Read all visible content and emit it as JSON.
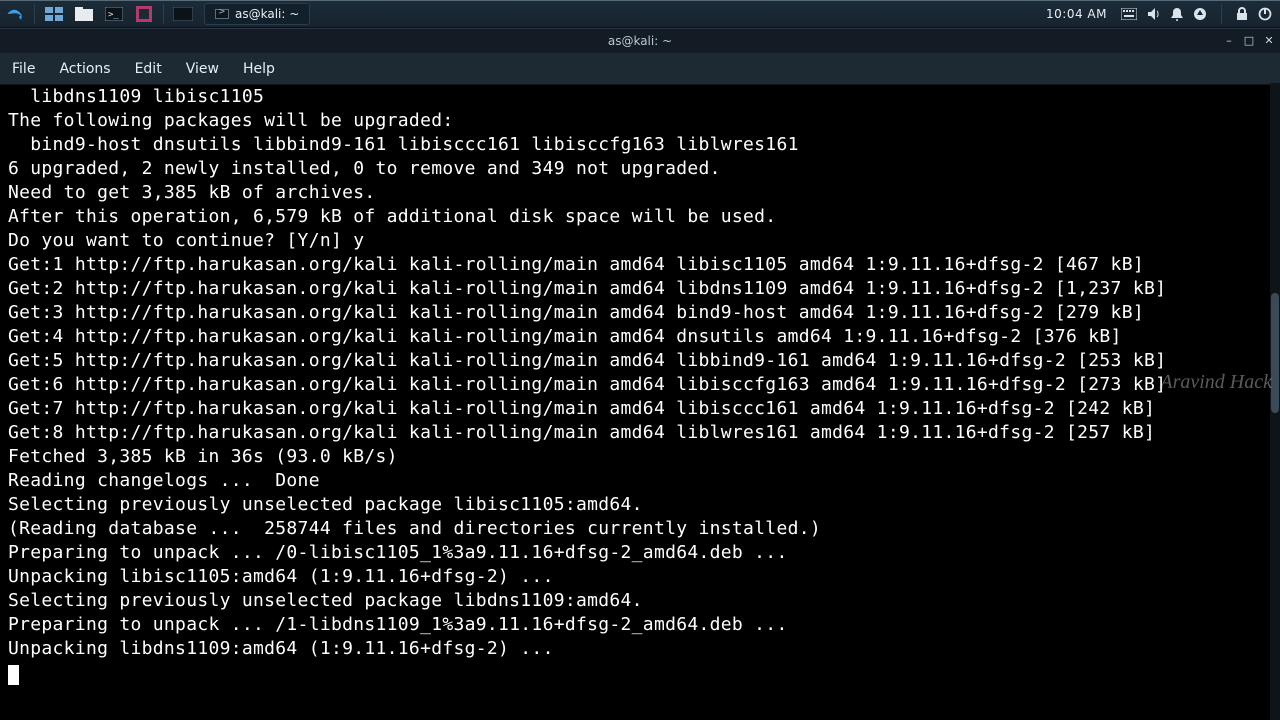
{
  "panel": {
    "taskbar_item": "as@kali: ~",
    "clock": "10:04 AM"
  },
  "window": {
    "title": "as@kali: ~",
    "menu": {
      "file": "File",
      "actions": "Actions",
      "edit": "Edit",
      "view": "View",
      "help": "Help"
    }
  },
  "watermark": "Aravind Hack",
  "terminal_lines": [
    "  libdns1109 libisc1105",
    "The following packages will be upgraded:",
    "  bind9-host dnsutils libbind9-161 libisccc161 libisccfg163 liblwres161",
    "6 upgraded, 2 newly installed, 0 to remove and 349 not upgraded.",
    "Need to get 3,385 kB of archives.",
    "After this operation, 6,579 kB of additional disk space will be used.",
    "Do you want to continue? [Y/n] y",
    "Get:1 http://ftp.harukasan.org/kali kali-rolling/main amd64 libisc1105 amd64 1:9.11.16+dfsg-2 [467 kB]",
    "Get:2 http://ftp.harukasan.org/kali kali-rolling/main amd64 libdns1109 amd64 1:9.11.16+dfsg-2 [1,237 kB]",
    "Get:3 http://ftp.harukasan.org/kali kali-rolling/main amd64 bind9-host amd64 1:9.11.16+dfsg-2 [279 kB]",
    "Get:4 http://ftp.harukasan.org/kali kali-rolling/main amd64 dnsutils amd64 1:9.11.16+dfsg-2 [376 kB]",
    "Get:5 http://ftp.harukasan.org/kali kali-rolling/main amd64 libbind9-161 amd64 1:9.11.16+dfsg-2 [253 kB]",
    "Get:6 http://ftp.harukasan.org/kali kali-rolling/main amd64 libisccfg163 amd64 1:9.11.16+dfsg-2 [273 kB]",
    "Get:7 http://ftp.harukasan.org/kali kali-rolling/main amd64 libisccc161 amd64 1:9.11.16+dfsg-2 [242 kB]",
    "Get:8 http://ftp.harukasan.org/kali kali-rolling/main amd64 liblwres161 amd64 1:9.11.16+dfsg-2 [257 kB]",
    "Fetched 3,385 kB in 36s (93.0 kB/s)",
    "Reading changelogs ...  Done",
    "Selecting previously unselected package libisc1105:amd64.",
    "(Reading database ...  258744 files and directories currently installed.)",
    "Preparing to unpack ... /0-libisc1105_1%3a9.11.16+dfsg-2_amd64.deb ...",
    "Unpacking libisc1105:amd64 (1:9.11.16+dfsg-2) ...",
    "Selecting previously unselected package libdns1109:amd64.",
    "Preparing to unpack ... /1-libdns1109_1%3a9.11.16+dfsg-2_amd64.deb ...",
    "Unpacking libdns1109:amd64 (1:9.11.16+dfsg-2) ..."
  ]
}
